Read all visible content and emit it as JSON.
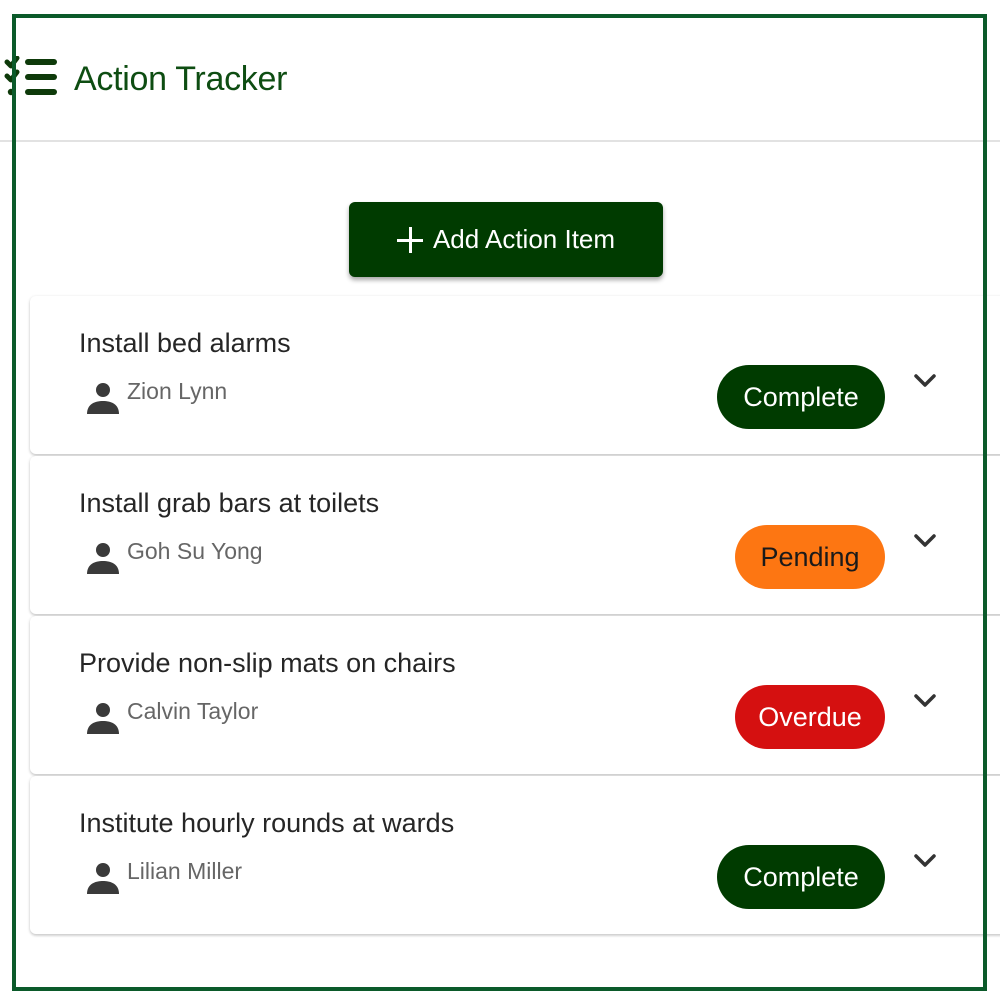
{
  "header": {
    "title": "Action Tracker",
    "icon": "checklist-icon"
  },
  "toolbar": {
    "add_label": "Add Action Item",
    "add_icon": "plus-icon"
  },
  "status_colors": {
    "Complete": {
      "bg": "#003b00",
      "fg": "#ffffff"
    },
    "Pending": {
      "bg": "#fd7612",
      "fg": "#1a1a1a"
    },
    "Overdue": {
      "bg": "#d51010",
      "fg": "#ffffff"
    }
  },
  "items": [
    {
      "title": "Install bed alarms",
      "assignee": "Zion Lynn",
      "status": "Complete"
    },
    {
      "title": "Install grab bars at toilets",
      "assignee": "Goh Su Yong",
      "status": "Pending"
    },
    {
      "title": "Provide non-slip mats on chairs",
      "assignee": "Calvin Taylor",
      "status": "Overdue"
    },
    {
      "title": "Institute hourly rounds at wards",
      "assignee": "Lilian Miller",
      "status": "Complete"
    }
  ]
}
